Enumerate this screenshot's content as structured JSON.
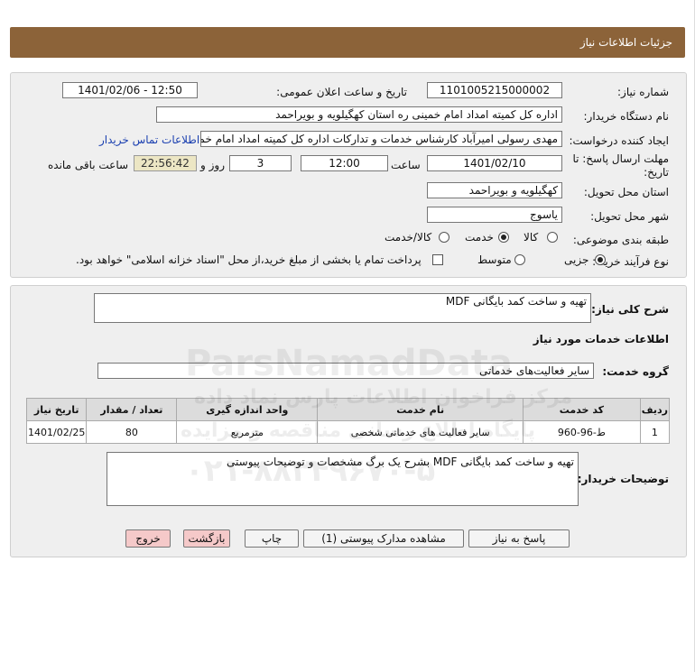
{
  "header": {
    "title": "جزئیات اطلاعات نیاز"
  },
  "form": {
    "need_number_label": "شماره نیاز:",
    "need_number": "1101005215000002",
    "announce_label": "تاریخ و ساعت اعلان عمومی:",
    "announce_value": "1401/02/06 - 12:50",
    "buyer_org_label": "نام دستگاه خریدار:",
    "buyer_org": "اداره کل کمیته امداد امام خمینی  ره  استان کهگیلویه و بویراحمد",
    "requester_label": "ایجاد کننده درخواست:",
    "requester": "مهدی رسولی امیرآباد کارشناس خدمات و تدارکات اداره کل کمیته امداد امام خمینی",
    "contact_link": "اطلاعات تماس خریدار",
    "deadline_label_1": "مهلت ارسال پاسخ: تا",
    "deadline_label_2": "تاریخ:",
    "deadline_date": "1401/02/10",
    "time_label": "ساعت",
    "deadline_time": "12:00",
    "days_value": "3",
    "days_label": "روز و",
    "remaining_time": "22:56:42",
    "remaining_label": "ساعت باقی مانده",
    "province_label": "استان محل تحویل:",
    "province": "کهگیلویه و بویراحمد",
    "city_label": "شهر محل تحویل:",
    "city": "یاسوج",
    "category_label": "طبقه بندی موضوعی:",
    "category_options": [
      "کالا",
      "خدمت",
      "کالا/خدمت"
    ],
    "category_selected": "خدمت",
    "process_label": "نوع فرآیند خرید :",
    "process_options": [
      "جزیی",
      "متوسط"
    ],
    "process_selected": "جزیی",
    "payment_note": "پرداخت تمام یا بخشی از مبلغ خرید،از محل \"اسناد خزانه اسلامی\" خواهد بود."
  },
  "details": {
    "summary_label": "شرح کلی نیاز:",
    "summary": "تهیه و ساخت کمد بایگانی MDF",
    "services_heading": "اطلاعات خدمات مورد نیاز",
    "service_group_label": "گروه خدمت:",
    "service_group": "سایر فعالیت‌های خدماتی",
    "table": {
      "headers": [
        "ردیف",
        "کد خدمت",
        "نام خدمت",
        "واحد اندازه گیری",
        "تعداد / مقدار",
        "تاریخ نیاز"
      ],
      "rows": [
        [
          "1",
          "ط-96-960",
          "سایر فعالیت های خدماتی شخصی",
          "مترمربع",
          "80",
          "1401/02/25"
        ]
      ]
    },
    "buyer_notes_label": "توضیحات خریدار:",
    "buyer_notes": "تهیه و ساخت کمد بایگانی MDF  بشرح یک برگ مشخصات و توضیحات پیوستی"
  },
  "buttons": {
    "reply": "پاسخ به نیاز",
    "view_docs": "مشاهده مدارک پیوستی (1)",
    "print": "چاپ",
    "back": "بازگشت",
    "exit": "خروج"
  },
  "watermark": {
    "brand": "ParsNamadData",
    "line1": "مرکز فراخوان اطلاعات پارس نماد داده",
    "line2": "پایگاه اطلاع رسانی مناقصه و مزایده",
    "phone": "۰۲۱-۸۸۳۴۹۶۷۰-۵"
  },
  "colors": {
    "header": "#8c6339",
    "panel": "#efefef",
    "timer": "#ece6c4",
    "exit_button": "#f5c9c9",
    "link": "#1a3fb0"
  }
}
